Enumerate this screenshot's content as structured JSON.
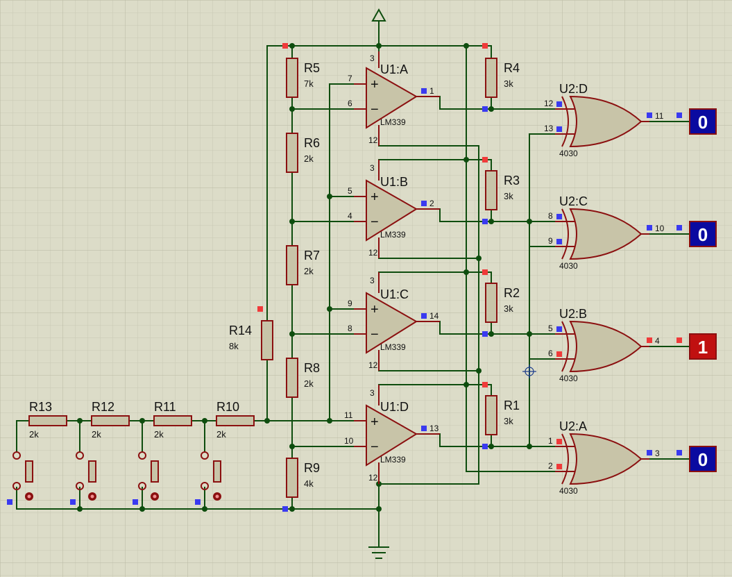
{
  "colors": {
    "background": "#dcdcc8",
    "grid_minor": "#c9c9b3",
    "grid_major": "#b9b9a2",
    "wire": "#0e4d0e",
    "component": "#8b1010",
    "component_fill": "#c8c4a8",
    "pin_logic_low": "#3a3af0",
    "pin_logic_high": "#f03a3a",
    "probe_low": "#0a0aa0",
    "probe_high": "#c01010"
  },
  "resistors": [
    {
      "ref": "R5",
      "value": "7k"
    },
    {
      "ref": "R6",
      "value": "2k"
    },
    {
      "ref": "R7",
      "value": "2k"
    },
    {
      "ref": "R8",
      "value": "2k"
    },
    {
      "ref": "R9",
      "value": "4k"
    },
    {
      "ref": "R4",
      "value": "3k"
    },
    {
      "ref": "R3",
      "value": "3k"
    },
    {
      "ref": "R2",
      "value": "3k"
    },
    {
      "ref": "R1",
      "value": "3k"
    },
    {
      "ref": "R14",
      "value": "8k"
    },
    {
      "ref": "R13",
      "value": "2k"
    },
    {
      "ref": "R12",
      "value": "2k"
    },
    {
      "ref": "R11",
      "value": "2k"
    },
    {
      "ref": "R10",
      "value": "2k"
    }
  ],
  "comparators": [
    {
      "ref": "U1:A",
      "part": "LM339",
      "pin_plus": "7",
      "pin_minus": "6",
      "pin_out": "1",
      "pin_vcc": "3",
      "pin_gnd": "12"
    },
    {
      "ref": "U1:B",
      "part": "LM339",
      "pin_plus": "5",
      "pin_minus": "4",
      "pin_out": "2",
      "pin_vcc": "3",
      "pin_gnd": "12"
    },
    {
      "ref": "U1:C",
      "part": "LM339",
      "pin_plus": "9",
      "pin_minus": "8",
      "pin_out": "14",
      "pin_vcc": "3",
      "pin_gnd": "12"
    },
    {
      "ref": "U1:D",
      "part": "LM339",
      "pin_plus": "11",
      "pin_minus": "10",
      "pin_out": "13",
      "pin_vcc": "3",
      "pin_gnd": "12"
    }
  ],
  "gates": [
    {
      "ref": "U2:D",
      "part": "4030",
      "pin_a": "12",
      "pin_b": "13",
      "pin_out": "11"
    },
    {
      "ref": "U2:C",
      "part": "4030",
      "pin_a": "8",
      "pin_b": "9",
      "pin_out": "10"
    },
    {
      "ref": "U2:B",
      "part": "4030",
      "pin_a": "5",
      "pin_b": "6",
      "pin_out": "4"
    },
    {
      "ref": "U2:A",
      "part": "4030",
      "pin_a": "1",
      "pin_b": "2",
      "pin_out": "3"
    }
  ],
  "probes": [
    {
      "value": "0",
      "state": "low"
    },
    {
      "value": "0",
      "state": "low"
    },
    {
      "value": "1",
      "state": "high"
    },
    {
      "value": "0",
      "state": "low"
    }
  ],
  "switches": [
    {
      "name": "switch-1"
    },
    {
      "name": "switch-2"
    },
    {
      "name": "switch-3"
    },
    {
      "name": "switch-4"
    }
  ]
}
